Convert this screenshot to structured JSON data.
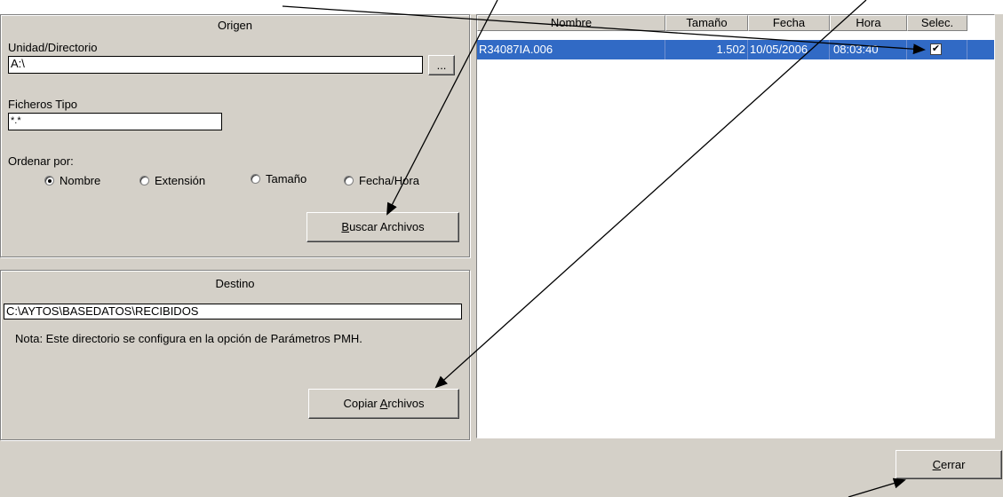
{
  "origen": {
    "title": "Origen",
    "unidad_label": "Unidad/Directorio",
    "unidad_value": "A:\\",
    "browse_label": "...",
    "ficheros_label": "Ficheros Tipo",
    "ficheros_value": "*.*",
    "ordenar_label": "Ordenar por:",
    "sort_options": [
      {
        "label": "Nombre",
        "checked": true
      },
      {
        "label": "Extensión",
        "checked": false
      },
      {
        "label": "Tamaño",
        "checked": false
      },
      {
        "label": "Fecha/Hora",
        "checked": false
      }
    ],
    "buscar_button": {
      "mnemonic": "B",
      "rest": "uscar Archivos"
    }
  },
  "destino": {
    "title": "Destino",
    "path_value": "C:\\AYTOS\\BASEDATOS\\RECIBIDOS",
    "nota": "Nota: Este directorio se configura en la opción de Parámetros PMH.",
    "copiar_button": {
      "prefix": "Copiar ",
      "mnemonic": "A",
      "rest": "rchivos"
    }
  },
  "file_list": {
    "columns": [
      "Nombre",
      "Tamaño",
      "Fecha",
      "Hora",
      "Selec."
    ],
    "rows": [
      {
        "nombre": "R34087IA.006",
        "tamano": "1.502",
        "fecha": "10/05/2006",
        "hora": "08:03:40",
        "selec": true
      }
    ]
  },
  "cerrar_button": {
    "mnemonic": "C",
    "rest": "errar"
  },
  "colors": {
    "selection": "#316ac5",
    "panel": "#d4d0c8"
  }
}
